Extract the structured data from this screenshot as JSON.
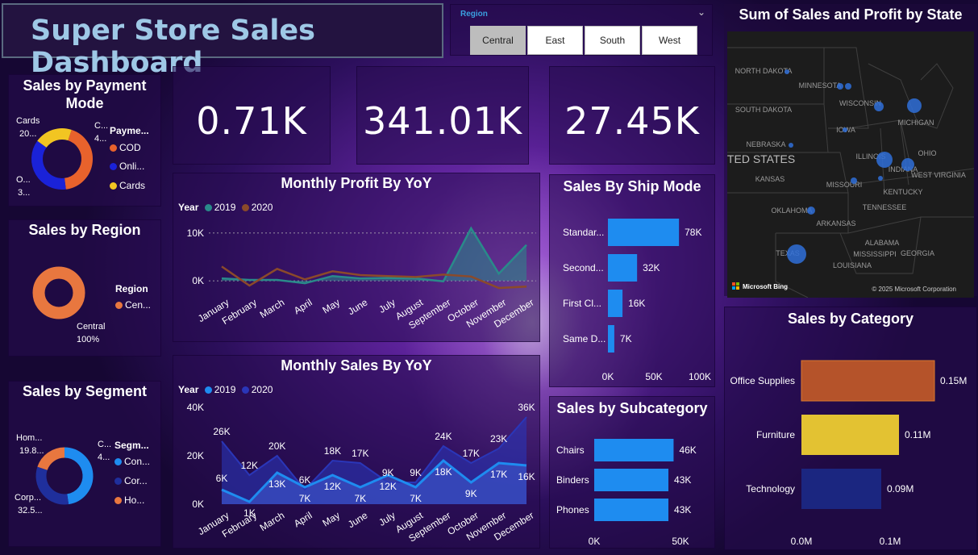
{
  "header": {
    "title": "Super Store Sales Dashboard"
  },
  "slicer": {
    "label": "Region",
    "options": [
      "Central",
      "East",
      "South",
      "West"
    ],
    "selected": "Central"
  },
  "kpis": [
    "0.71K",
    "341.01K",
    "27.45K"
  ],
  "payment": {
    "title": "Sales by Payment Mode",
    "legend_title": "Payme...",
    "legend": [
      "COD",
      "Onli...",
      "Cards"
    ],
    "labels": {
      "cards": "Cards",
      "cards_val": "20...",
      "cod": "C...",
      "cod_val": "4...",
      "online": "O...",
      "online_val": "3..."
    },
    "slices": [
      {
        "name": "COD",
        "value": 43,
        "color": "#e8622c"
      },
      {
        "name": "Online",
        "value": 37,
        "color": "#1a22d8"
      },
      {
        "name": "Cards",
        "value": 20,
        "color": "#f2c522"
      }
    ]
  },
  "region": {
    "title": "Sales by Region",
    "legend_title": "Region",
    "legend": [
      "Cen..."
    ],
    "label": "Central",
    "label_pct": "100%",
    "slices": [
      {
        "name": "Central",
        "value": 100,
        "color": "#e8773f"
      }
    ]
  },
  "segment": {
    "title": "Sales by Segment",
    "legend_title": "Segm...",
    "legend": [
      "Con...",
      "Cor...",
      "Ho..."
    ],
    "labels": {
      "home": "Hom...",
      "home_val": "19.8...",
      "cons": "C...",
      "cons_val": "4...",
      "corp": "Corp...",
      "corp_val": "32.5..."
    },
    "slices": [
      {
        "name": "Consumer",
        "value": 47.7,
        "color": "#1e8cf0"
      },
      {
        "name": "Corporate",
        "value": 32.5,
        "color": "#1f2f9c"
      },
      {
        "name": "Home Office",
        "value": 19.8,
        "color": "#e8773f"
      }
    ]
  },
  "profit_chart": {
    "title": "Monthly Profit By YoY",
    "legend_title": "Year",
    "series_names": [
      "2019",
      "2020"
    ],
    "y_ticks": [
      "10K",
      "0K"
    ],
    "months": [
      "January",
      "February",
      "March",
      "April",
      "May",
      "June",
      "July",
      "August",
      "September",
      "October",
      "November",
      "December"
    ]
  },
  "sales_chart": {
    "title": "Monthly Sales By YoY",
    "legend_title": "Year",
    "series_names": [
      "2019",
      "2020"
    ],
    "y_ticks": [
      "40K",
      "20K",
      "0K"
    ],
    "labels_2020": [
      "26K",
      "12K",
      "20K",
      "6K",
      "18K",
      "17K",
      "9K",
      "9K",
      "24K",
      "17K",
      "23K",
      "36K"
    ],
    "labels_2019": [
      "6K",
      "1K",
      "13K",
      "7K",
      "12K",
      "7K",
      "12K",
      "7K",
      "18K",
      "9K",
      "17K",
      "16K"
    ]
  },
  "ship_mode": {
    "title": "Sales By Ship Mode",
    "categories": [
      "Standar...",
      "Second...",
      "First Cl...",
      "Same D..."
    ],
    "values": [
      "78K",
      "32K",
      "16K",
      "7K"
    ],
    "x_ticks": [
      "0K",
      "50K",
      "100K"
    ]
  },
  "map": {
    "title": "Sum of Sales and Profit by State",
    "labels": [
      "NORTH DAKOTA",
      "MINNESOTA",
      "SOUTH DAKOTA",
      "WISCONSIN",
      "MICHIGAN",
      "IOWA",
      "NEBRASKA",
      "UNITED STATES",
      "ILLINOIS",
      "INDIANA",
      "OHIO",
      "KANSAS",
      "MISSOURI",
      "KENTUCKY",
      "WEST VIRGINIA",
      "OKLAHOMA",
      "TENNESSEE",
      "ARKANSAS",
      "ALABAMA",
      "TEXAS",
      "MISSISSIPPI",
      "LOUISIANA",
      "GEORGIA"
    ],
    "bing": "Microsoft Bing",
    "copyright": "© 2025 Microsoft Corporation"
  },
  "subcategory": {
    "title": "Sales by Subcategory",
    "categories": [
      "Chairs",
      "Binders",
      "Phones"
    ],
    "values": [
      "46K",
      "43K",
      "43K"
    ],
    "x_ticks": [
      "0K",
      "50K"
    ]
  },
  "category": {
    "title": "Sales by Category",
    "categories": [
      "Office Supplies",
      "Furniture",
      "Technology"
    ],
    "values": [
      "0.15M",
      "0.11M",
      "0.09M"
    ],
    "x_ticks": [
      "0.0M",
      "0.1M"
    ]
  },
  "chart_data": [
    {
      "type": "line",
      "title": "Monthly Profit By YoY",
      "categories": [
        "January",
        "February",
        "March",
        "April",
        "May",
        "June",
        "July",
        "August",
        "September",
        "October",
        "November",
        "December"
      ],
      "series": [
        {
          "name": "2019",
          "color": "#2a8a8a",
          "values": [
            500,
            200,
            200,
            -500,
            1000,
            500,
            600,
            500,
            -100,
            11000,
            1500,
            7500
          ]
        },
        {
          "name": "2020",
          "color": "#8b4a2a",
          "values": [
            3000,
            -1000,
            2500,
            300,
            2000,
            1200,
            1000,
            800,
            1300,
            900,
            -1500,
            -1200
          ]
        }
      ],
      "ylim": [
        -2000,
        12000
      ]
    },
    {
      "type": "area",
      "title": "Monthly Sales By YoY",
      "categories": [
        "January",
        "February",
        "March",
        "April",
        "May",
        "June",
        "July",
        "August",
        "September",
        "October",
        "November",
        "December"
      ],
      "series": [
        {
          "name": "2019",
          "color": "#1e8cf0",
          "values": [
            6000,
            1000,
            13000,
            7000,
            12000,
            7000,
            12000,
            7000,
            18000,
            9000,
            17000,
            16000
          ]
        },
        {
          "name": "2020",
          "color": "#2a36b8",
          "values": [
            26000,
            12000,
            20000,
            6000,
            18000,
            17000,
            9000,
            9000,
            24000,
            17000,
            23000,
            36000
          ]
        }
      ],
      "ylim": [
        0,
        40000
      ]
    },
    {
      "type": "bar",
      "title": "Sales By Ship Mode",
      "categories": [
        "Standar...",
        "Second...",
        "First Cl...",
        "Same D..."
      ],
      "values": [
        78,
        32,
        16,
        7
      ],
      "xlim": [
        0,
        100
      ]
    },
    {
      "type": "bar",
      "title": "Sales by Subcategory",
      "categories": [
        "Chairs",
        "Binders",
        "Phones"
      ],
      "values": [
        46,
        43,
        43
      ],
      "xlim": [
        0,
        50
      ]
    },
    {
      "type": "bar",
      "title": "Sales by Category",
      "categories": [
        "Office Supplies",
        "Furniture",
        "Technology"
      ],
      "values": [
        0.15,
        0.11,
        0.09
      ],
      "colors": [
        "#b5532a",
        "#e3c232",
        "#1b2680"
      ],
      "xlim": [
        0,
        0.1
      ]
    }
  ]
}
